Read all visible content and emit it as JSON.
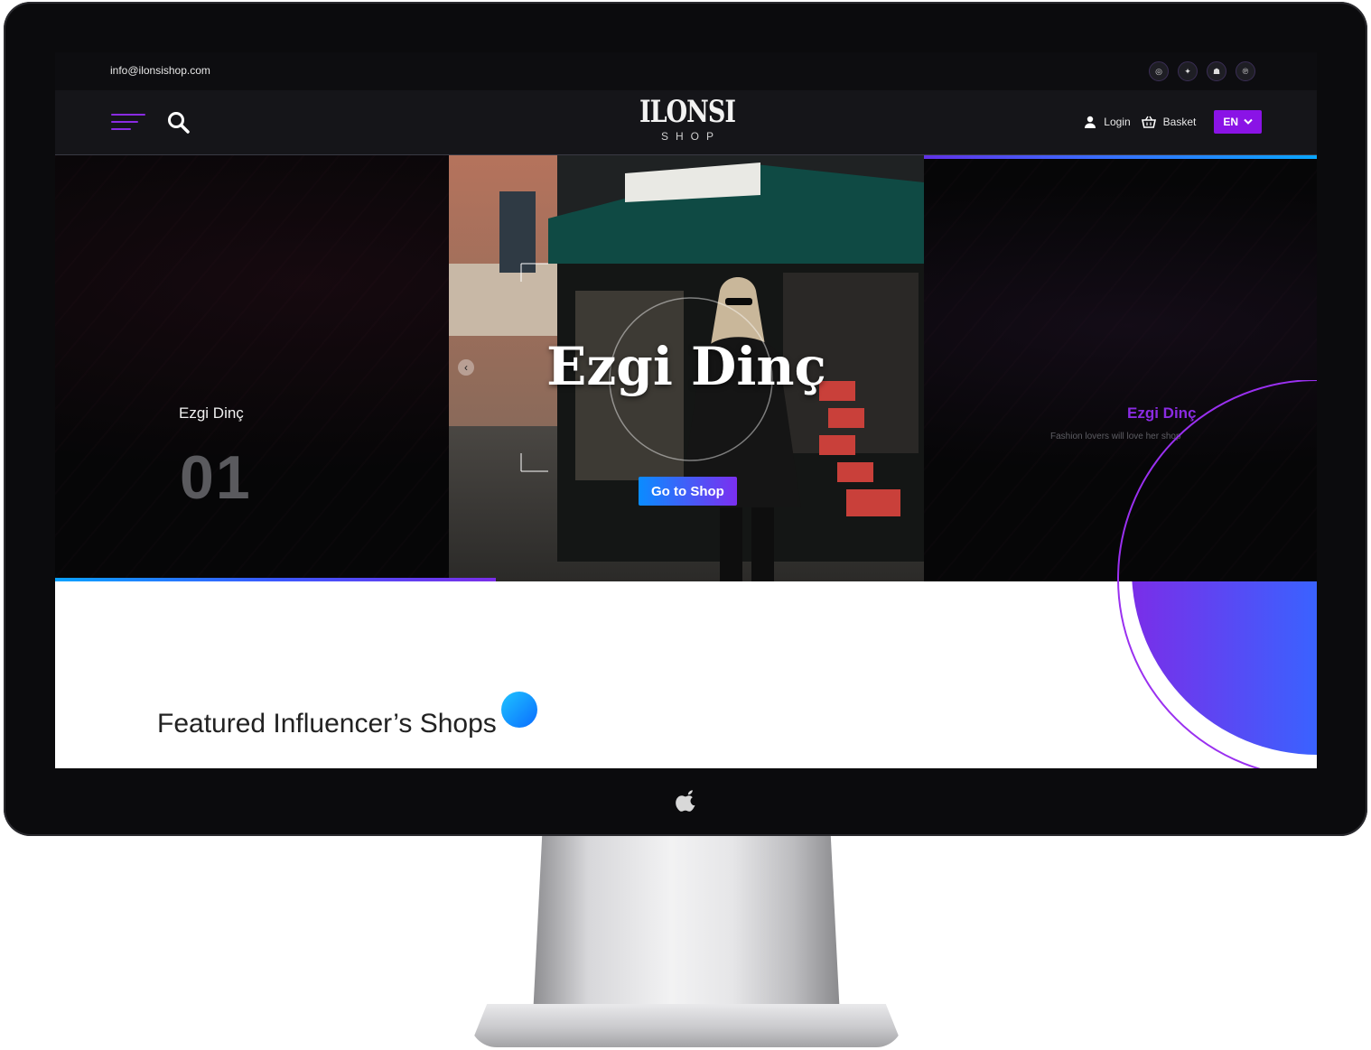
{
  "topbar": {
    "email": "info@ilonsishop.com",
    "socials": [
      {
        "icon": "instagram-icon",
        "glyph": "◎"
      },
      {
        "icon": "twitter-icon",
        "glyph": "✦"
      },
      {
        "icon": "snapchat-icon",
        "glyph": "☗"
      },
      {
        "icon": "pinterest-icon",
        "glyph": "℗"
      }
    ]
  },
  "navbar": {
    "logo_main": "ILONSI",
    "logo_sub": "SHOP",
    "login_label": "Login",
    "basket_label": "Basket",
    "language": "EN"
  },
  "hero": {
    "left_name": "Ezgi Dinç",
    "left_number": "01",
    "title": "Ezgi Dinç",
    "button_label": "Go to Shop",
    "right_name": "Ezgi Dinç",
    "right_subtitle": "Fashion lovers will love her shop"
  },
  "featured": {
    "title": "Featured Influencer’s Shops"
  },
  "colors": {
    "accent_purple": "#8a13e6",
    "accent_blue": "#0a9cff"
  }
}
